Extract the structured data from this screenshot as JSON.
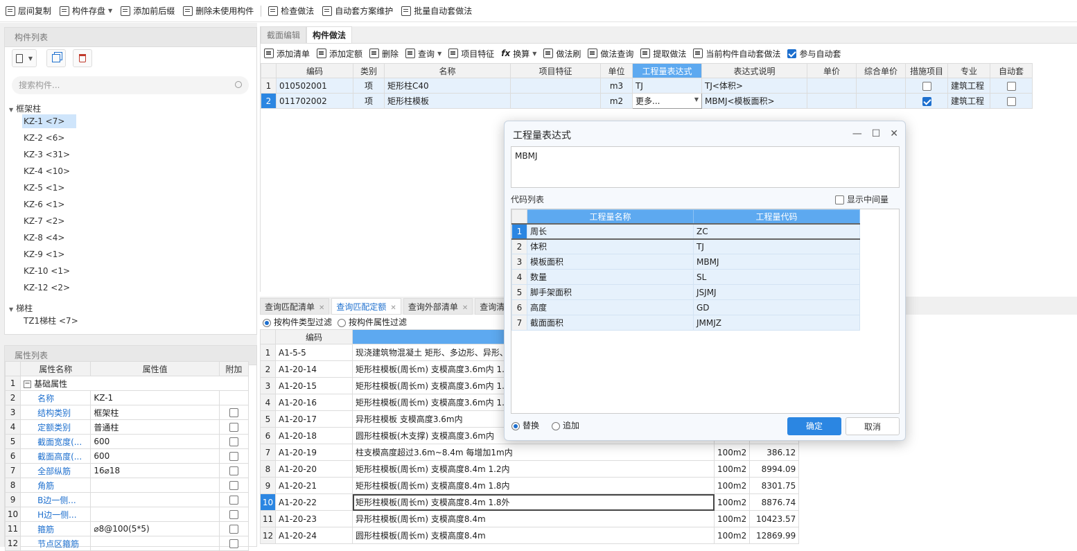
{
  "toolbar": {
    "items": [
      "层间复制",
      "构件存盘",
      "添加前后缀",
      "删除未使用构件",
      "检查做法",
      "自动套方案维护",
      "批量自动套做法"
    ]
  },
  "left": {
    "comp_title": "构件列表",
    "search_placeholder": "搜索构件...",
    "groups": [
      {
        "label": "框架柱",
        "items": [
          "KZ-1 <7>",
          "KZ-2 <6>",
          "KZ-3 <31>",
          "KZ-4 <10>",
          "KZ-5 <1>",
          "KZ-6 <1>",
          "KZ-7 <2>",
          "KZ-8 <4>",
          "KZ-9 <1>",
          "KZ-10 <1>",
          "KZ-12 <2>"
        ]
      },
      {
        "label": "梯柱",
        "items": [
          "TZ1梯柱 <7>"
        ]
      }
    ],
    "prop_title": "属性列表",
    "prop_headers": [
      "属性名称",
      "属性值",
      "附加"
    ],
    "props": [
      {
        "n": "1",
        "name": "基础属性",
        "value": ""
      },
      {
        "n": "2",
        "name": "名称",
        "value": "KZ-1"
      },
      {
        "n": "3",
        "name": "结构类别",
        "value": "框架柱"
      },
      {
        "n": "4",
        "name": "定额类别",
        "value": "普通柱"
      },
      {
        "n": "5",
        "name": "截面宽度(...",
        "value": "600"
      },
      {
        "n": "6",
        "name": "截面高度(...",
        "value": "600"
      },
      {
        "n": "7",
        "name": "全部纵筋",
        "value": "16⌀18"
      },
      {
        "n": "8",
        "name": "角筋",
        "value": ""
      },
      {
        "n": "9",
        "name": "B边一侧...",
        "value": ""
      },
      {
        "n": "10",
        "name": "H边一侧...",
        "value": ""
      },
      {
        "n": "11",
        "name": "箍筋",
        "value": "⌀8@100(5*5)"
      },
      {
        "n": "12",
        "name": "节点区箍筋",
        "value": ""
      }
    ]
  },
  "main": {
    "tabs": [
      "截面编辑",
      "构件做法"
    ],
    "sub_toolbar": [
      "添加清单",
      "添加定额",
      "删除",
      "查询",
      "项目特征",
      "换算",
      "做法刷",
      "做法查询",
      "提取做法",
      "当前构件自动套做法",
      "参与自动套"
    ],
    "headers": [
      "编码",
      "类别",
      "名称",
      "项目特征",
      "单位",
      "工程量表达式",
      "表达式说明",
      "单价",
      "综合单价",
      "措施项目",
      "专业",
      "自动套"
    ],
    "rows": [
      {
        "n": "1",
        "code": "010502001",
        "type": "项",
        "name": "矩形柱C40",
        "feature": "",
        "unit": "m3",
        "expr": "TJ",
        "desc": "TJ<体积>",
        "price": "",
        "total": "",
        "major": "建筑工程"
      },
      {
        "n": "2",
        "code": "011702002",
        "type": "项",
        "name": "矩形柱模板",
        "feature": "",
        "unit": "m2",
        "expr": "更多...",
        "desc": "MBMJ<模板面积>",
        "price": "",
        "total": "",
        "major": "建筑工程"
      }
    ]
  },
  "bottom": {
    "tabs": [
      "查询匹配清单",
      "查询匹配定额",
      "查询外部清单",
      "查询清"
    ],
    "filter1": "按构件类型过滤",
    "filter2": "按构件属性过滤",
    "code_header": "编码",
    "rows": [
      {
        "n": "1",
        "code": "A1-5-5",
        "name": "现浇建筑物混凝土 矩形、多边形、异形、",
        "unit": "",
        "price": ""
      },
      {
        "n": "2",
        "code": "A1-20-14",
        "name": "矩形柱模板(周长m) 支模高度3.6m内 1.2",
        "unit": "",
        "price": ""
      },
      {
        "n": "3",
        "code": "A1-20-15",
        "name": "矩形柱模板(周长m) 支模高度3.6m内 1.8",
        "unit": "",
        "price": ""
      },
      {
        "n": "4",
        "code": "A1-20-16",
        "name": "矩形柱模板(周长m) 支模高度3.6m内 1.8",
        "unit": "",
        "price": ""
      },
      {
        "n": "5",
        "code": "A1-20-17",
        "name": "异形柱模板 支模高度3.6m内",
        "unit": "",
        "price": ""
      },
      {
        "n": "6",
        "code": "A1-20-18",
        "name": "圆形柱模板(木支撑) 支模高度3.6m内",
        "unit": "",
        "price": ""
      },
      {
        "n": "7",
        "code": "A1-20-19",
        "name": "柱支模高度超过3.6m~8.4m 每增加1m内",
        "unit": "100m2",
        "price": "386.12"
      },
      {
        "n": "8",
        "code": "A1-20-20",
        "name": "矩形柱模板(周长m) 支模高度8.4m 1.2内",
        "unit": "100m2",
        "price": "8994.09"
      },
      {
        "n": "9",
        "code": "A1-20-21",
        "name": "矩形柱模板(周长m) 支模高度8.4m 1.8内",
        "unit": "100m2",
        "price": "8301.75"
      },
      {
        "n": "10",
        "code": "A1-20-22",
        "name": "矩形柱模板(周长m) 支模高度8.4m 1.8外",
        "unit": "100m2",
        "price": "8876.74"
      },
      {
        "n": "11",
        "code": "A1-20-23",
        "name": "异形柱模板(周长m) 支模高度8.4m",
        "unit": "100m2",
        "price": "10423.57"
      },
      {
        "n": "12",
        "code": "A1-20-24",
        "name": "圆形柱模板(周长m) 支模高度8.4m",
        "unit": "100m2",
        "price": "12869.99"
      }
    ]
  },
  "dialog": {
    "title": "工程量表达式",
    "expression": "MBMJ",
    "code_label": "代码列表",
    "show_mid": "显示中间量",
    "headers": [
      "工程量名称",
      "工程量代码"
    ],
    "rows": [
      {
        "n": "1",
        "name": "周长",
        "code": "ZC"
      },
      {
        "n": "2",
        "name": "体积",
        "code": "TJ"
      },
      {
        "n": "3",
        "name": "模板面积",
        "code": "MBMJ"
      },
      {
        "n": "4",
        "name": "数量",
        "code": "SL"
      },
      {
        "n": "5",
        "name": "脚手架面积",
        "code": "JSJMJ"
      },
      {
        "n": "6",
        "name": "高度",
        "code": "GD"
      },
      {
        "n": "7",
        "name": "截面面积",
        "code": "JMMJZ"
      }
    ],
    "mode_replace": "替换",
    "mode_append": "追加",
    "ok": "确定",
    "cancel": "取消"
  }
}
